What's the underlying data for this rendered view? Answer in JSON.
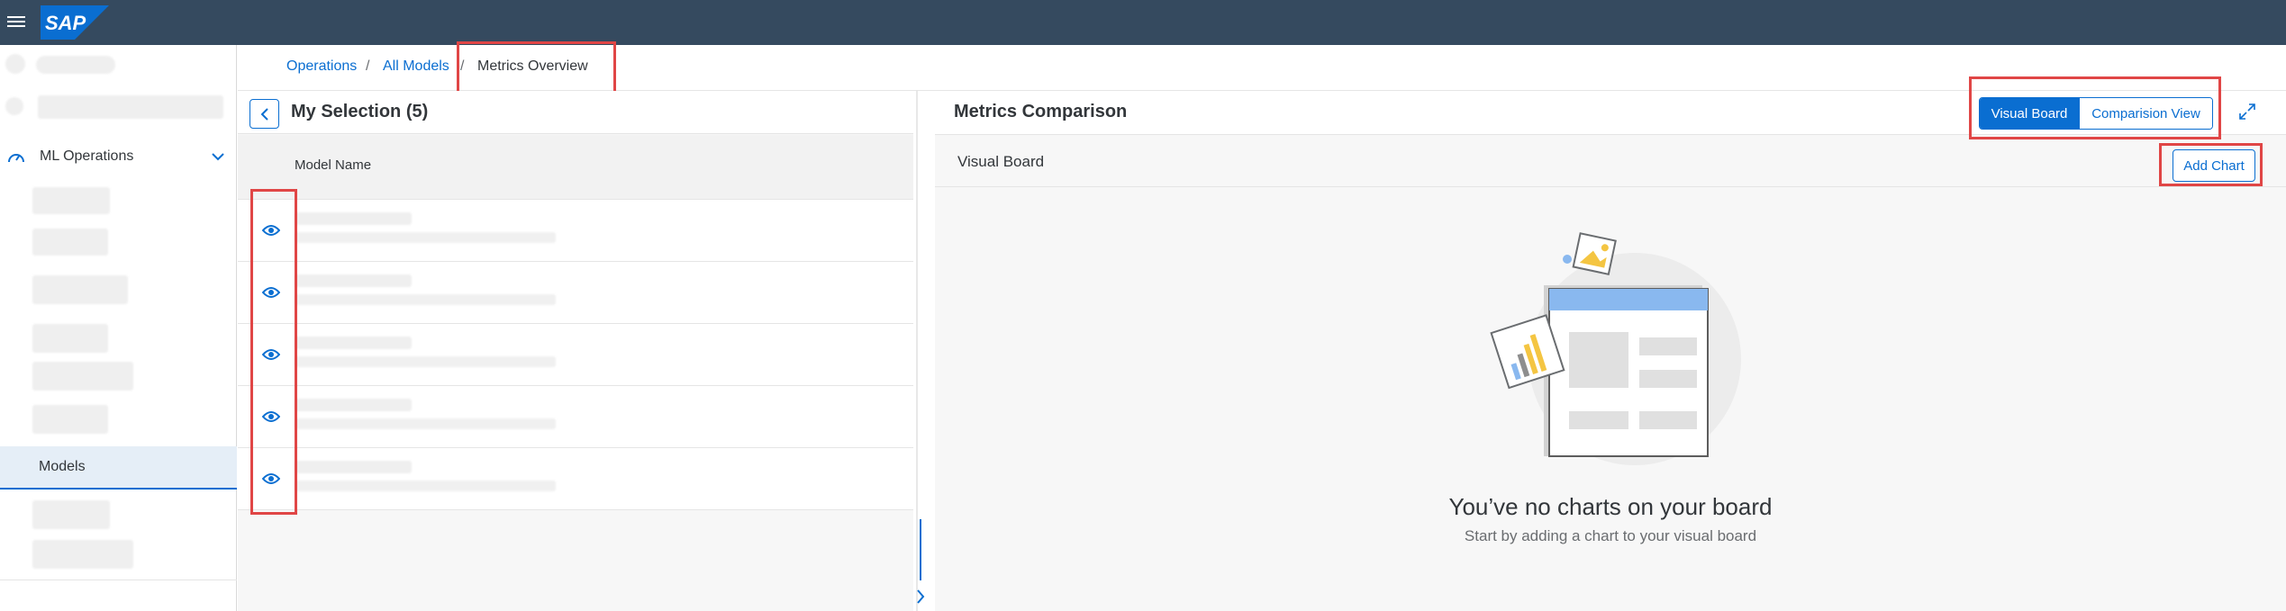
{
  "shell": {
    "logo_text": "SAP",
    "brand_color": "#354a5f",
    "accent_color": "#0a6ed1"
  },
  "sidenav": {
    "ml_operations": {
      "label": "ML Operations",
      "icon": "gauge-icon"
    },
    "models": {
      "label": "Models"
    }
  },
  "breadcrumb": {
    "items": [
      "Operations",
      "All Models"
    ],
    "separator": "/",
    "current": "Metrics Overview"
  },
  "selection": {
    "title": "My Selection (5)",
    "column_header": "Model Name",
    "row_icon": "eye-icon"
  },
  "comparison": {
    "title": "Metrics Comparison",
    "segments": {
      "visual_board": "Visual Board",
      "comparison_view": "Comparision View"
    },
    "toolbar_label": "Visual Board",
    "add_chart": "Add Chart",
    "empty_title": "You’ve no charts on your board",
    "empty_subtitle": "Start by adding a chart to your visual board"
  }
}
